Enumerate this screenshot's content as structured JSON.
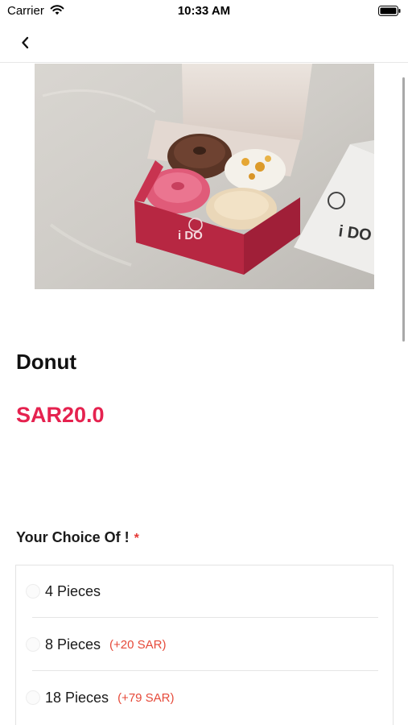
{
  "status_bar": {
    "carrier": "Carrier",
    "time": "10:33 AM"
  },
  "product": {
    "name": "Donut",
    "price": "SAR20.0",
    "image_box_text": "i DO",
    "image_bag_text": "i DO"
  },
  "options_section": {
    "heading": "Your Choice Of !",
    "required_mark": "*",
    "options": [
      {
        "label": "4 Pieces",
        "extra": ""
      },
      {
        "label": "8 Pieces",
        "extra": "(+20 SAR)"
      },
      {
        "label": "18 Pieces",
        "extra": "(+79 SAR)"
      }
    ]
  },
  "colors": {
    "price": "#e5224f",
    "extra_price": "#e64a3a",
    "required": "#e53935"
  }
}
